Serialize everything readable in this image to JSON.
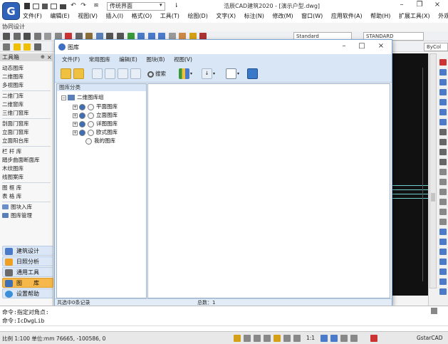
{
  "app": {
    "title": "浩辰CAD建筑2020 - [演示户型.dwg]",
    "logo_letter": "G",
    "workspace": "传统界面",
    "menus": [
      "文件(F)",
      "编辑(E)",
      "视图(V)",
      "插入(I)",
      "格式(O)",
      "工具(T)",
      "绘图(D)",
      "文字(X)",
      "标注(N)",
      "修改(M)",
      "窗口(W)",
      "应用软件(A)",
      "帮助(H)",
      "扩展工具(X)",
      "外观"
    ],
    "collab": "协同设计",
    "style_combo": "Standard",
    "text_style_combo": "STANDARD",
    "bylayer_combo": "ByCol"
  },
  "toolbox": {
    "title": "工具箱",
    "close": "×",
    "groups": [
      [
        "动态图库",
        "二维图库",
        "多视图库"
      ],
      [
        "二维门库",
        "二维窗库",
        "三维门窗库"
      ],
      [
        "剖面门窗库",
        "立面门窗库",
        "立面阳台库"
      ],
      [
        "栏 杆 库",
        "踏步曲面断面库",
        "木纹图库",
        "线图案库"
      ],
      [
        "图 框 库",
        "表 格 库"
      ],
      [
        "图块入库",
        "图库管理"
      ]
    ],
    "categories": [
      "建筑设计",
      "日照分析",
      "通用工具",
      "图　　库",
      "设置帮助"
    ]
  },
  "dialog": {
    "title": "图库",
    "menus": [
      "文件(F)",
      "常用图库",
      "编辑(E)",
      "图块(B)",
      "视图(V)"
    ],
    "search_label": "搜索",
    "tree_header": "图库分类",
    "tree": {
      "root": "二维图库组",
      "children": [
        "平面图库",
        "立面图库",
        "详图图库",
        "欧式图库",
        "我的图库"
      ]
    },
    "status_left": "共选中0条记录",
    "status_total": "总数：1"
  },
  "command": {
    "line1": "命令:指定对角点:",
    "line2": "命令:IcDwgLib"
  },
  "statusbar": {
    "scale": "比例 1:100",
    "unit": "单位:mm",
    "coords": "76665, -100586, 0",
    "zoom": "1:1",
    "brand": "GstarCAD"
  }
}
